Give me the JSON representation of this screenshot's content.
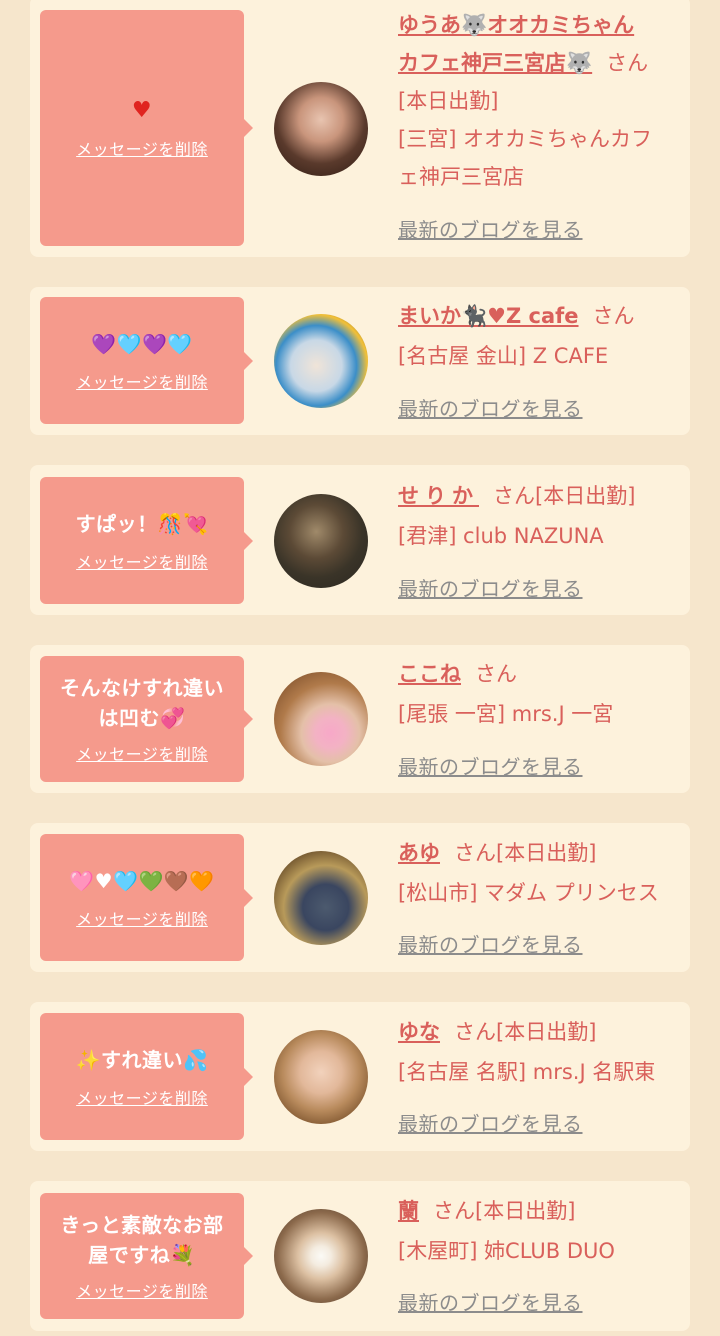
{
  "delete_label": "メッセージを削除",
  "blog_label": "最新のブログを見る",
  "san": "さん",
  "colors": {
    "page_bg": "#f6e6cc",
    "card_bg": "#fdf2dc",
    "bubble": "#f59a8c",
    "accent": "#d9605b",
    "link_gray": "#8c8c8c"
  },
  "items": [
    {
      "message": "♥",
      "name_l1": "ゆうあ🐺オオカミちゃん",
      "name_l2": "カフェ神戸三宮店🐺",
      "status": "",
      "shop_l1": "[本日出勤]",
      "shop_l2": "[三宮] オオカミちゃんカフ",
      "shop_l3": "ェ神戸三宮店"
    },
    {
      "message": "💜🩵💜🩵",
      "name": "まいか🐈‍⬛♥Z cafe",
      "status": "",
      "shop": "[名古屋 金山] Z CAFE"
    },
    {
      "message": "すぱッ！🎊💘",
      "name": "せりか",
      "status": "[本日出勤]",
      "shop": "[君津] club NAZUNA"
    },
    {
      "message_l1": "そんなけすれ違い",
      "message_l2": "は凹む💞",
      "name": "ここね",
      "status": "",
      "shop": "[尾張 一宮] mrs.J 一宮"
    },
    {
      "message": "🩷♥🩵💚🤎🧡",
      "name": "あゆ",
      "status": "[本日出勤]",
      "shop": "[松山市] マダム プリンセス"
    },
    {
      "message": "✨すれ違い💦",
      "name": "ゆな",
      "status": "[本日出勤]",
      "shop": "[名古屋 名駅] mrs.J 名駅東"
    },
    {
      "message_l1": "きっと素敵なお部",
      "message_l2": "屋ですね💐",
      "name": "蘭",
      "status": "[本日出勤]",
      "shop": "[木屋町] 姉CLUB DUO"
    }
  ]
}
